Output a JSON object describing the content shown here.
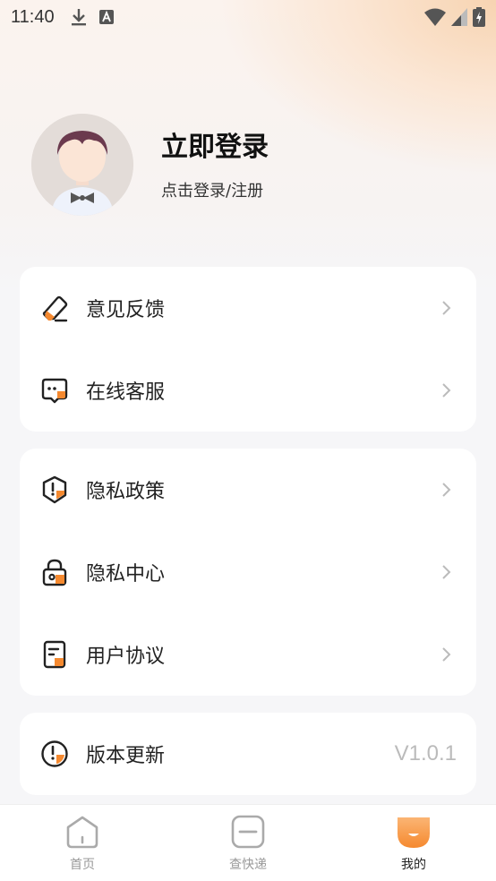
{
  "status_bar": {
    "time": "11:40",
    "icons": [
      "download-icon",
      "a-badge-icon",
      "wifi-icon",
      "signal-icon",
      "battery-charging-icon"
    ]
  },
  "profile": {
    "title": "立即登录",
    "subtitle": "点击登录/注册",
    "avatar_icon": "default-avatar-icon"
  },
  "menu_group_1": [
    {
      "label": "意见反馈",
      "icon": "feedback-eraser-icon"
    },
    {
      "label": "在线客服",
      "icon": "chat-bubble-icon"
    }
  ],
  "menu_group_2": [
    {
      "label": "隐私政策",
      "icon": "shield-alert-icon"
    },
    {
      "label": "隐私中心",
      "icon": "lock-icon"
    },
    {
      "label": "用户协议",
      "icon": "document-icon"
    }
  ],
  "menu_group_3": [
    {
      "label": "版本更新",
      "icon": "info-circle-icon",
      "value": "V1.0.1"
    }
  ],
  "tabbar": {
    "tabs": [
      {
        "label": "首页",
        "icon": "home-icon",
        "active": false
      },
      {
        "label": "查快递",
        "icon": "search-package-icon",
        "active": false
      },
      {
        "label": "我的",
        "icon": "profile-face-icon",
        "active": true
      }
    ]
  },
  "colors": {
    "accent": "#f5892f",
    "accent_light": "#fbb574",
    "text_primary": "#222222",
    "chevron": "#bbbbbb"
  }
}
